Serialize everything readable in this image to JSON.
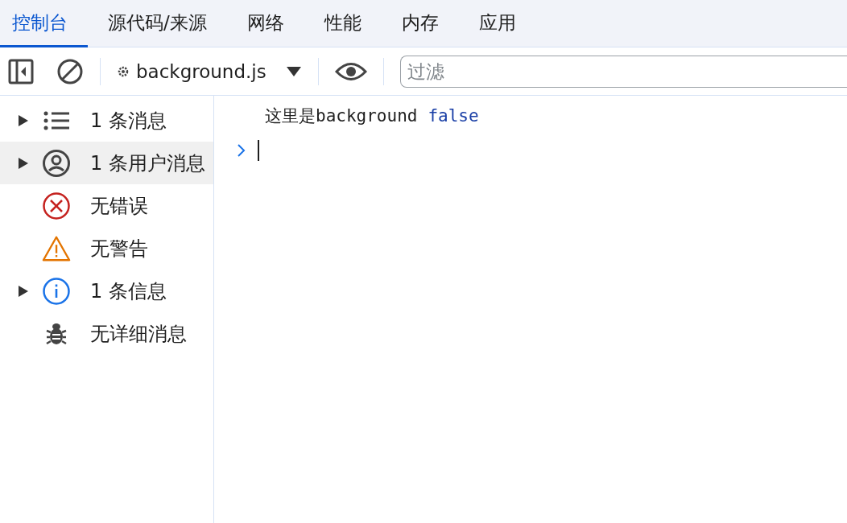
{
  "tabs": [
    {
      "label": "控制台",
      "selected": true
    },
    {
      "label": "源代码/来源",
      "selected": false
    },
    {
      "label": "网络",
      "selected": false
    },
    {
      "label": "性能",
      "selected": false
    },
    {
      "label": "内存",
      "selected": false
    },
    {
      "label": "应用",
      "selected": false
    }
  ],
  "toolbar": {
    "context": "background.js",
    "filter": {
      "placeholder": "过滤"
    }
  },
  "sidebar": {
    "items": [
      {
        "label": "1 条消息",
        "kind": "list",
        "expandable": true,
        "selected": false
      },
      {
        "label": "1 条用户消息",
        "kind": "user",
        "expandable": true,
        "selected": true
      },
      {
        "label": "无错误",
        "kind": "error",
        "expandable": false,
        "selected": false
      },
      {
        "label": "无警告",
        "kind": "warning",
        "expandable": false,
        "selected": false
      },
      {
        "label": "1 条信息",
        "kind": "info",
        "expandable": true,
        "selected": false
      },
      {
        "label": "无详细消息",
        "kind": "verbose",
        "expandable": false,
        "selected": false
      }
    ]
  },
  "console": {
    "messages": [
      {
        "parts": [
          {
            "kind": "text",
            "text": "这里是background"
          },
          {
            "kind": "boolean",
            "text": "false"
          }
        ]
      }
    ]
  }
}
